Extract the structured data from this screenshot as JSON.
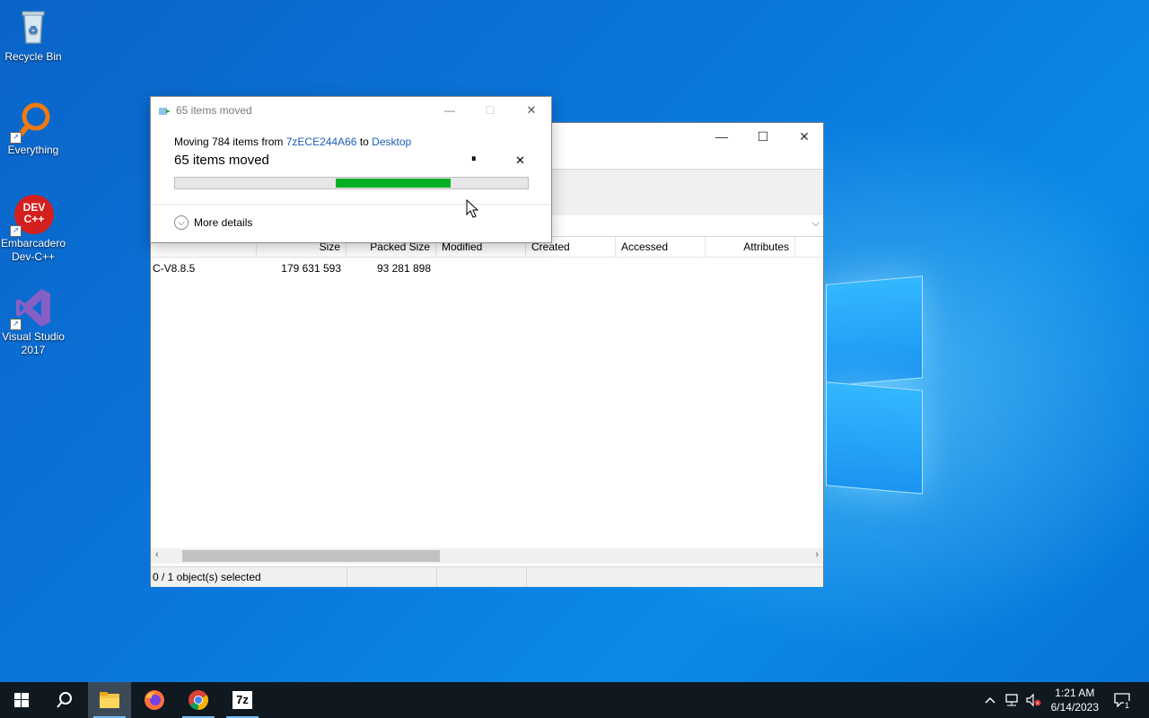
{
  "desktop": {
    "icons": [
      {
        "label": "Recycle Bin"
      },
      {
        "label": "Everything"
      },
      {
        "label": "Embarcadero Dev-C++"
      },
      {
        "label": "Visual Studio 2017"
      }
    ],
    "devcpp_logo_text": "DEV C++"
  },
  "zip_window": {
    "columns": [
      "Size",
      "Packed Size",
      "Modified",
      "Created",
      "Accessed",
      "Attributes"
    ],
    "rows": [
      {
        "name": "C-V8.8.5",
        "size": "179 631 593",
        "packed_size": "93 281 898",
        "modified": "",
        "created": "",
        "accessed": "",
        "attributes": ""
      }
    ],
    "status": "0 / 1 object(s) selected",
    "controls": {
      "minimize": "—",
      "maximize": "☐",
      "close": "✕"
    }
  },
  "progress_dialog": {
    "title": "65 items moved",
    "line_prefix": "Moving 784 items from",
    "source": "7zECE244A66",
    "line_to": "to",
    "destination": "Desktop",
    "headline": "65 items moved",
    "progress_start": 0.455,
    "progress_end": 0.78,
    "pause_icon": "⏸",
    "cancel_icon": "✕",
    "more_details": "More details",
    "controls": {
      "minimize": "—",
      "maximize": "☐",
      "close": "✕"
    }
  },
  "taskbar": {
    "apps": [
      "start-button",
      "search-button",
      "file-explorer",
      "firefox",
      "chrome",
      "7zip"
    ],
    "zip_label": "7z",
    "clock_time": "1:21 AM",
    "clock_date": "6/14/2023",
    "notification_count": "1"
  },
  "colors": {
    "progress": "#06b025",
    "link": "#1a5fb4",
    "taskbar": "#101820"
  }
}
